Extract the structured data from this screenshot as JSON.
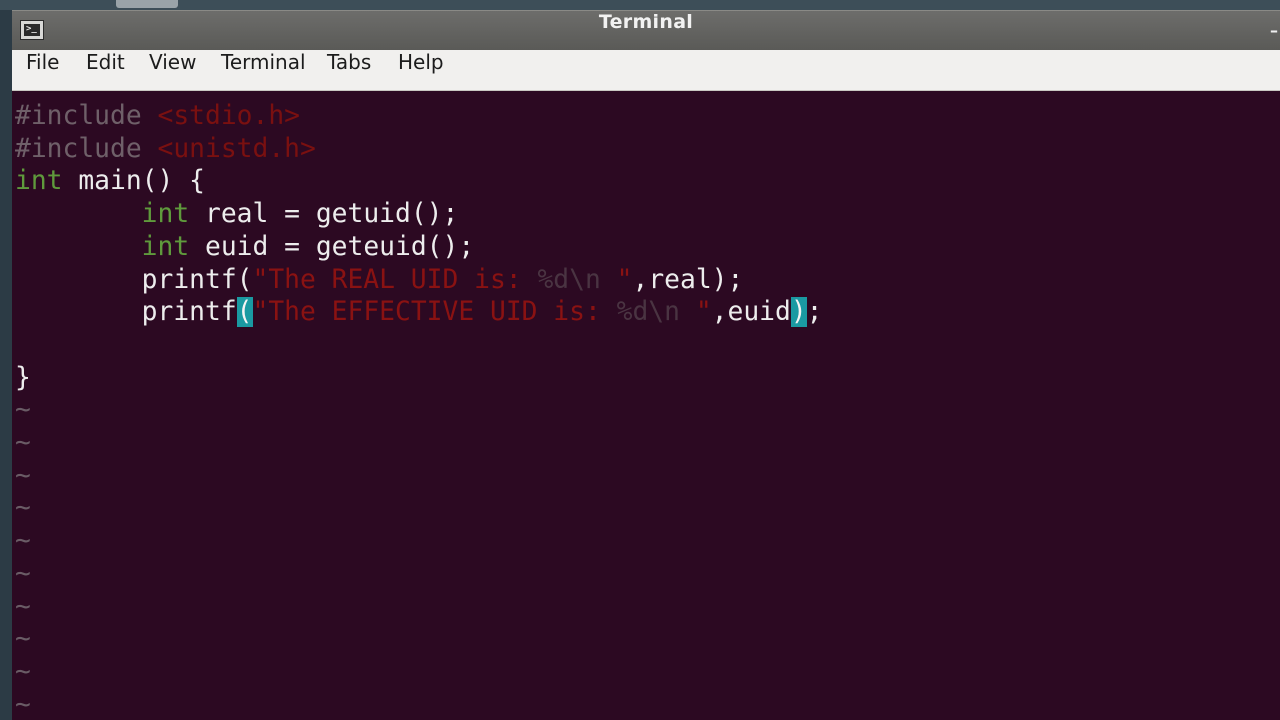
{
  "window": {
    "title": "Terminal",
    "close_glyph": "–"
  },
  "menu": {
    "items": [
      "File",
      "Edit",
      "View",
      "Terminal",
      "Tabs",
      "Help"
    ]
  },
  "editor": {
    "lines": [
      [
        {
          "t": "#include ",
          "c": "pre"
        },
        {
          "t": "<stdio.h>",
          "c": "inc"
        }
      ],
      [
        {
          "t": "#include ",
          "c": "pre"
        },
        {
          "t": "<unistd.h>",
          "c": "inc"
        }
      ],
      [
        {
          "t": "int",
          "c": "kw"
        },
        {
          "t": " main() {",
          "c": "plain"
        }
      ],
      [
        {
          "t": "        ",
          "c": "plain"
        },
        {
          "t": "int",
          "c": "kw"
        },
        {
          "t": " real = getuid();",
          "c": "plain"
        }
      ],
      [
        {
          "t": "        ",
          "c": "plain"
        },
        {
          "t": "int",
          "c": "kw"
        },
        {
          "t": " euid = geteuid();",
          "c": "plain"
        }
      ],
      [
        {
          "t": "        printf(",
          "c": "plain"
        },
        {
          "t": "\"The REAL UID is: ",
          "c": "str"
        },
        {
          "t": "%d\\n ",
          "c": "fmt"
        },
        {
          "t": "\"",
          "c": "str"
        },
        {
          "t": ",real);",
          "c": "plain"
        }
      ],
      [
        {
          "t": "        printf",
          "c": "plain"
        },
        {
          "t": "(",
          "c": "match"
        },
        {
          "t": "\"The EFFECTIVE UID is: ",
          "c": "str"
        },
        {
          "t": "%d\\n ",
          "c": "fmt"
        },
        {
          "t": "\"",
          "c": "str"
        },
        {
          "t": ",euid",
          "c": "plain"
        },
        {
          "t": ")",
          "c": "match"
        },
        {
          "t": ";",
          "c": "plain"
        }
      ],
      [],
      [
        {
          "t": "}",
          "c": "plain"
        }
      ],
      [
        {
          "t": "~",
          "c": "tilde"
        }
      ],
      [
        {
          "t": "~",
          "c": "tilde"
        }
      ],
      [
        {
          "t": "~",
          "c": "tilde"
        }
      ],
      [
        {
          "t": "~",
          "c": "tilde"
        }
      ],
      [
        {
          "t": "~",
          "c": "tilde"
        }
      ],
      [
        {
          "t": "~",
          "c": "tilde"
        }
      ],
      [
        {
          "t": "~",
          "c": "tilde"
        }
      ],
      [
        {
          "t": "~",
          "c": "tilde"
        }
      ],
      [
        {
          "t": "~",
          "c": "tilde"
        }
      ],
      [
        {
          "t": "~",
          "c": "tilde"
        }
      ]
    ]
  },
  "icons": {
    "app": "terminal-icon",
    "prompt_glyph": ">_"
  },
  "colors": {
    "background": "#2c0922",
    "keyword": "#5f9a3c",
    "string": "#8a1212",
    "preprocessor": "#6f6069",
    "match_highlight": "#1a9aa2"
  }
}
